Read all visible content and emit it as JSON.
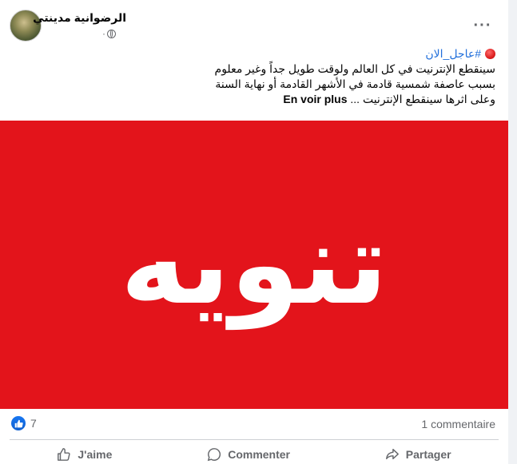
{
  "post": {
    "author": "الرضوانية مدينتي",
    "time": "·",
    "more_icon": "more-horizontal-icon",
    "privacy_icon": "globe-icon",
    "hashtag": "#عاجل_الان",
    "lines": [
      "سينقطع الإنترنيت في كل العالم ولوقت طويل جداً وغير معلوم",
      "بسبب عاصفة شمسية قادمة في الأشهر القادمة  أو نهاية السنة",
      "وعلى اثرها سينقطع الإنترنيت ..."
    ],
    "see_more": "En voir plus",
    "banner_text": "تنويه",
    "banner_color": "#e3141b"
  },
  "stats": {
    "reactions_count": "7",
    "comments": "1 commentaire"
  },
  "actions": {
    "like": "J'aime",
    "comment": "Commenter",
    "share": "Partager"
  }
}
